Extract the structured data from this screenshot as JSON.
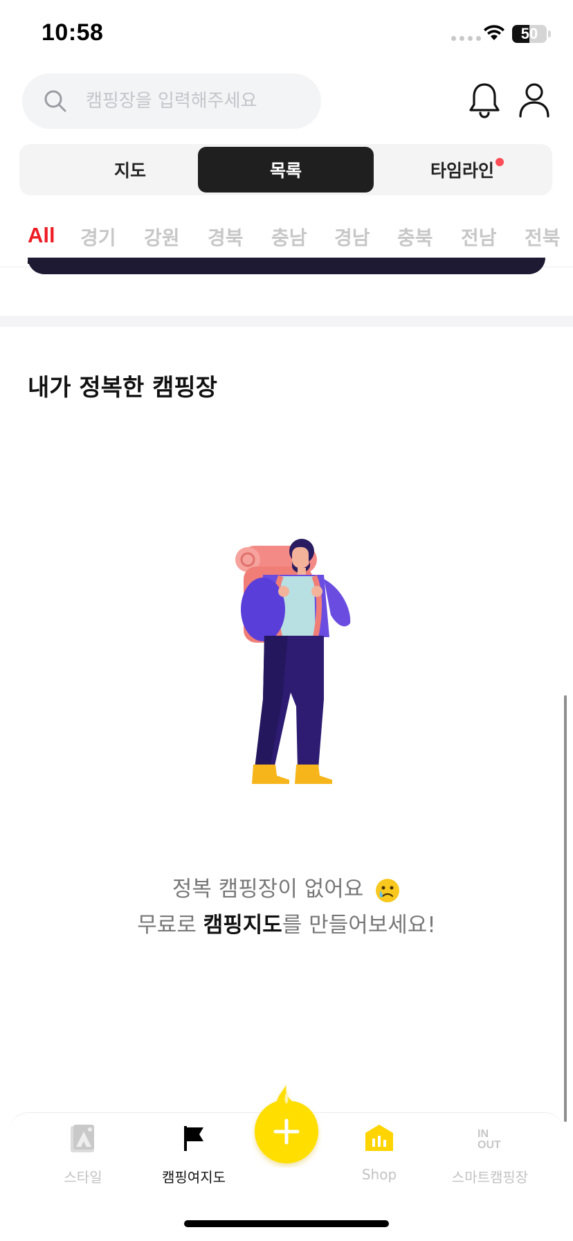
{
  "status_bar": {
    "time": "10:58",
    "battery": "50",
    "battery_level_percent": 50
  },
  "search": {
    "placeholder": "캠핑장을 입력해주세요"
  },
  "view_tabs": [
    {
      "label": "지도",
      "active": false
    },
    {
      "label": "목록",
      "active": true
    },
    {
      "label": "타임라인",
      "active": false,
      "has_notification_dot": true
    }
  ],
  "regions": [
    "All",
    "경기",
    "강원",
    "경북",
    "충남",
    "경남",
    "충북",
    "전남",
    "전북"
  ],
  "active_region": "All",
  "section": {
    "title": "내가 정복한 캠핑장",
    "empty_line1": "정복 캠핑장이 없어요",
    "empty_line2_prefix": "무료로 ",
    "empty_line2_strong": "캠핑지도",
    "empty_line2_suffix": "를 만들어보세요!"
  },
  "bottom_nav": {
    "style": "스타일",
    "camp_map": "캠핑여지도",
    "shop": "Shop",
    "smart_camp": "스마트캠핑장",
    "inout_in": "IN",
    "inout_out": "OUT"
  },
  "colors": {
    "accent_red": "#ee1c25",
    "fab_yellow": "#ffde00",
    "dark_segment": "#1f1f1f",
    "notification_dot": "#ff4d57"
  },
  "icons": [
    "search-icon",
    "bell-icon",
    "user-icon",
    "style-icon",
    "flag-icon",
    "plus-icon",
    "shop-icon",
    "wifi-icon",
    "battery-icon"
  ]
}
